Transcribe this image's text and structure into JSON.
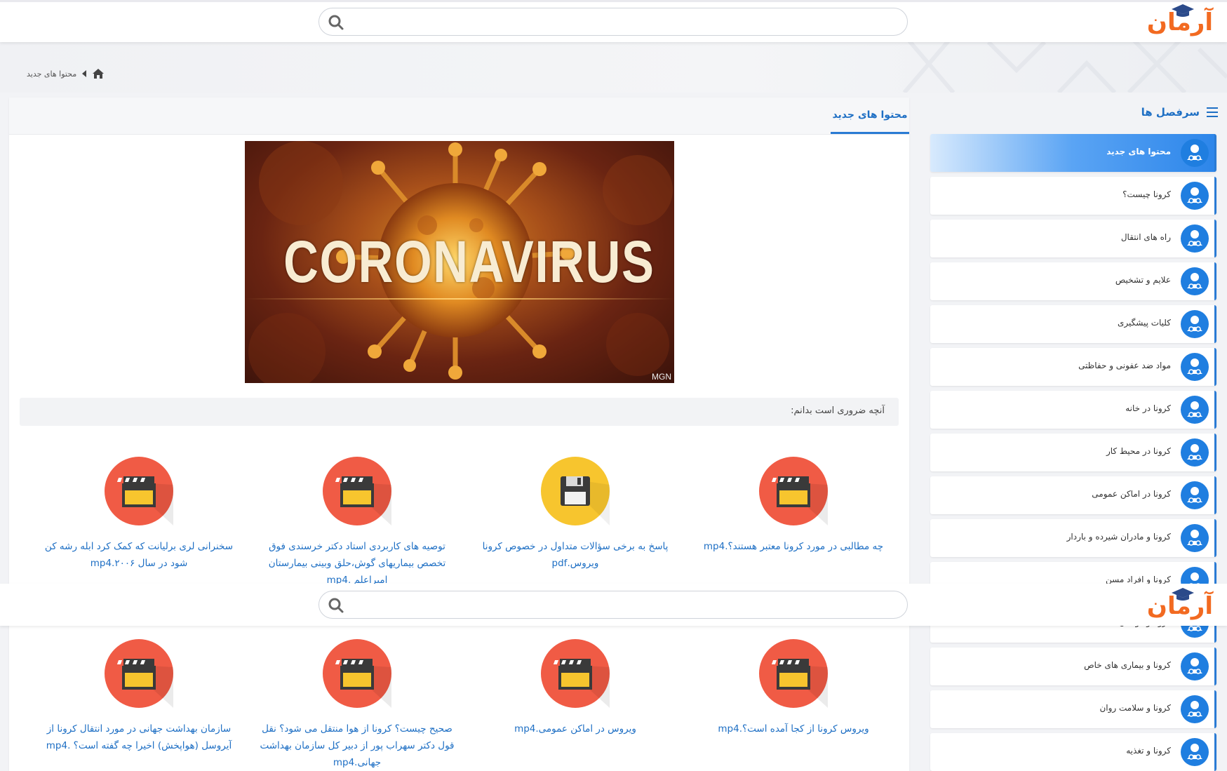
{
  "header": {
    "logo_text": "آرمان",
    "search_placeholder": ""
  },
  "breadcrumb": {
    "current": "محتوا های جدید"
  },
  "main": {
    "tab_label": "محتوا های جدید",
    "hero_text": "CORONAVIRUS",
    "hero_credit": "MGN",
    "notice": "آنچه ضروری است بدانم:",
    "items": [
      {
        "title": "چه مطالبی در مورد کرونا معتبر هستند؟.mp4",
        "icon": "clapperboard-icon",
        "color": "#f05b45"
      },
      {
        "title": "پاسخ به برخی سؤالات متداول در خصوص کرونا ویروس.pdf",
        "icon": "floppy-disk-icon",
        "color": "#f7c52e"
      },
      {
        "title": "توصیه های کاربردی استاد دکتر خرسندی فوق تخصص بیماریهای گوش،حلق وبینی بیمارستان امیراعلم .mp4",
        "icon": "clapperboard-icon",
        "color": "#f05b45"
      },
      {
        "title": "سخنرانی لری برلیانت که کمک کرد ابله رشه کن شود در سال ۲۰۰۶.mp4",
        "icon": "clapperboard-icon",
        "color": "#f05b45"
      },
      {
        "title": "ویروس کرونا از کجا آمده است؟.mp4",
        "icon": "clapperboard-icon",
        "color": "#f05b45"
      },
      {
        "title": "ویروس در اماکن عمومی.mp4",
        "icon": "clapperboard-icon",
        "color": "#f05b45"
      },
      {
        "title": "صحیح چیست؟ کرونا از هوا منتقل می شود؟ نقل قول دکتر سهراب پور از دبیر کل سازمان بهداشت جهانی.mp4",
        "icon": "clapperboard-icon",
        "color": "#f05b45"
      },
      {
        "title": "سازمان بهداشت جهانی در مورد انتقال کرونا از آیروسل (هواپخش) اخیرا چه گفته است؟ .mp4",
        "icon": "clapperboard-icon",
        "color": "#f05b45"
      }
    ]
  },
  "sidebar": {
    "heading": "سرفصل ها",
    "items": [
      {
        "label": "محتوا های جدید",
        "active": true
      },
      {
        "label": "کرونا چیست؟"
      },
      {
        "label": "راه های انتقال"
      },
      {
        "label": "علایم و تشخیص"
      },
      {
        "label": "کلیات پیشگیری"
      },
      {
        "label": "مواد ضد عفونی و حفاظتی"
      },
      {
        "label": "کرونا در خانه"
      },
      {
        "label": "کرونا در محیط کار"
      },
      {
        "label": "کرونا در اماکن عمومی"
      },
      {
        "label": "کرونا و مادران شیرده و باردار"
      },
      {
        "label": "کرونا و افراد مسن"
      },
      {
        "label": "کرونا و کودکان"
      },
      {
        "label": "کرونا و بیماری های خاص"
      },
      {
        "label": "کرونا و سلامت روان"
      },
      {
        "label": "کرونا و تغذیه"
      }
    ]
  },
  "colors": {
    "accent": "#1e6fc4",
    "logo": "#f26a21"
  }
}
